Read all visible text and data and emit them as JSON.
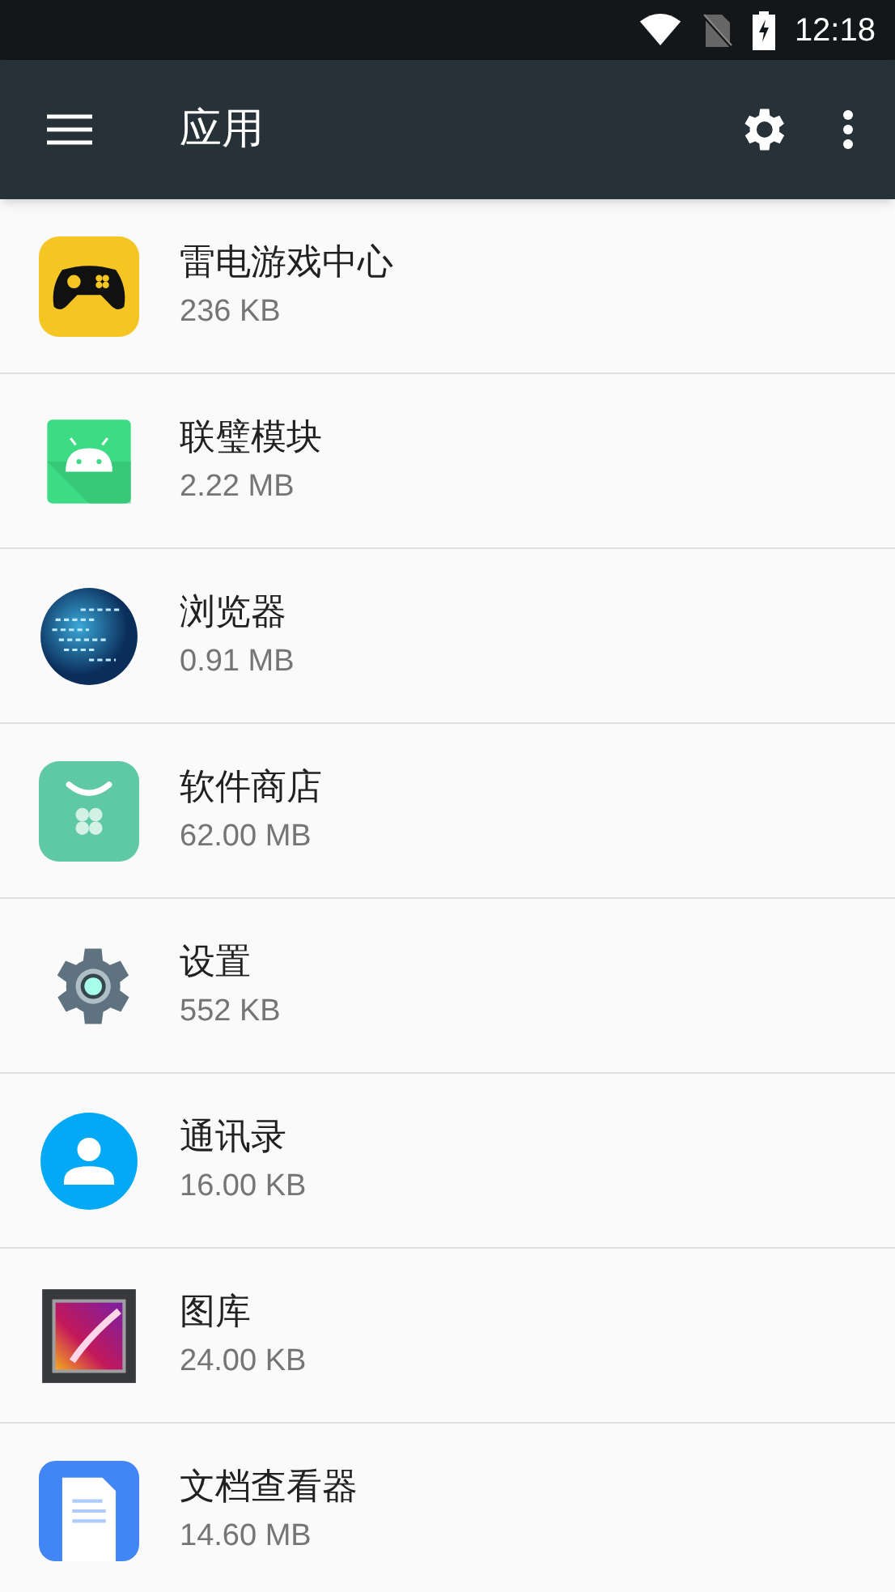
{
  "status_bar": {
    "time": "12:18"
  },
  "toolbar": {
    "title": "应用"
  },
  "apps": [
    {
      "kind": "game",
      "name": "雷电游戏中心",
      "size": "236 KB"
    },
    {
      "kind": "android",
      "name": "联璧模块",
      "size": "2.22 MB"
    },
    {
      "kind": "globe",
      "name": "浏览器",
      "size": "0.91 MB"
    },
    {
      "kind": "store",
      "name": "软件商店",
      "size": "62.00 MB"
    },
    {
      "kind": "settings",
      "name": "设置",
      "size": "552 KB"
    },
    {
      "kind": "contacts",
      "name": "通讯录",
      "size": "16.00 KB"
    },
    {
      "kind": "gallery",
      "name": "图库",
      "size": "24.00 KB"
    },
    {
      "kind": "document",
      "name": "文档查看器",
      "size": "14.60 MB"
    }
  ]
}
